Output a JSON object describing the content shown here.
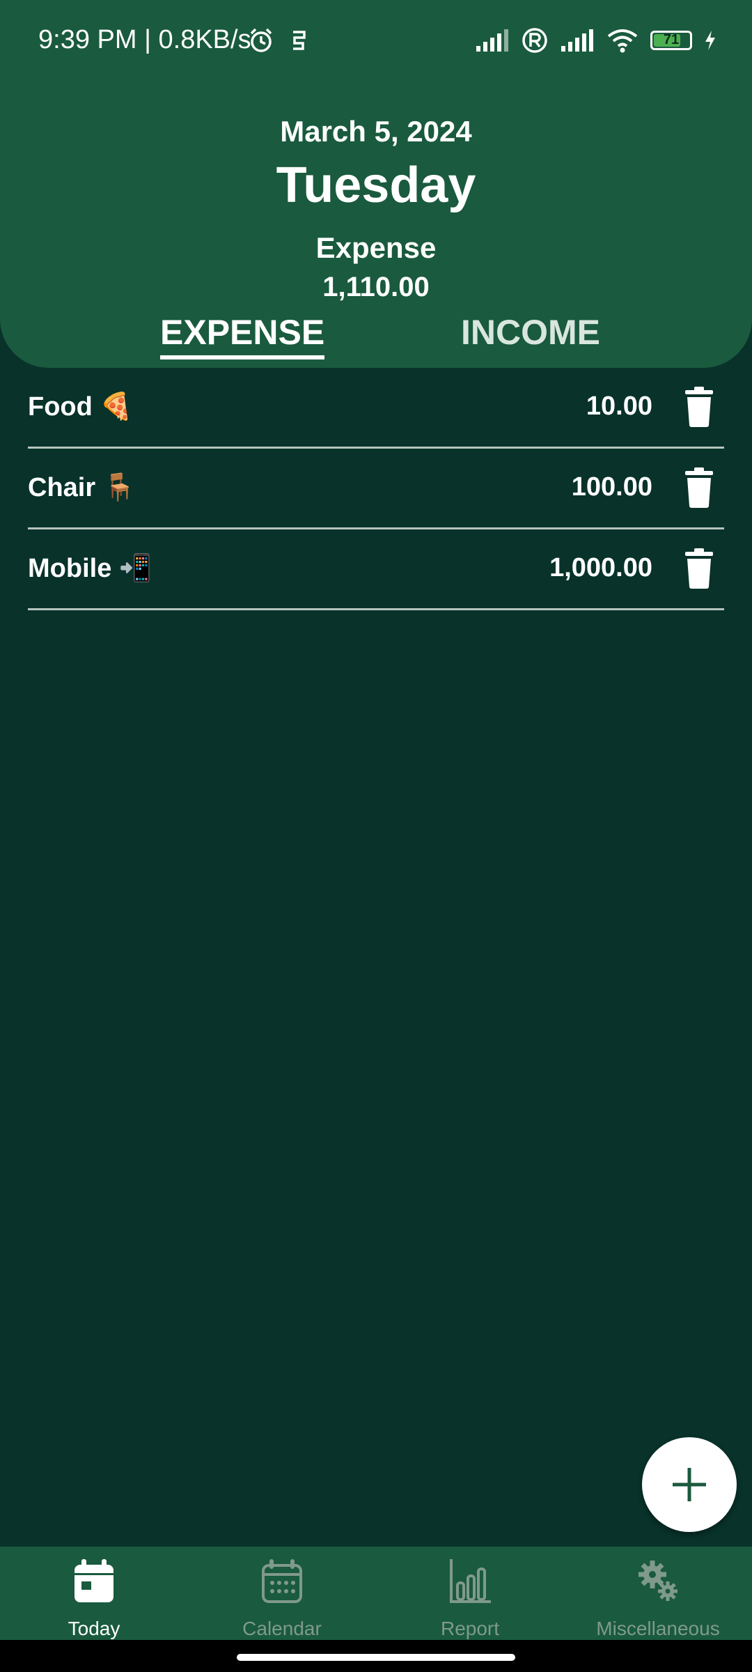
{
  "status_bar": {
    "time_and_speed": "9:39 PM | 0.8KB/s",
    "battery_level": "71",
    "icons": [
      "alarm-icon",
      "notification-icon",
      "signal-icon",
      "registered-icon",
      "signal-icon",
      "wifi-icon",
      "battery-icon",
      "charging-icon"
    ]
  },
  "header": {
    "date": "March 5, 2024",
    "weekday": "Tuesday",
    "summary_label": "Expense",
    "summary_value": "1,110.00"
  },
  "tabs": [
    {
      "label": "EXPENSE",
      "active": true
    },
    {
      "label": "INCOME",
      "active": false
    }
  ],
  "entries": [
    {
      "name": "Food 🍕",
      "amount": "10.00",
      "icon": "trash-icon"
    },
    {
      "name": "Chair 🪑",
      "amount": "100.00",
      "icon": "trash-icon"
    },
    {
      "name": "Mobile 📲",
      "amount": "1,000.00",
      "icon": "trash-icon"
    }
  ],
  "fab": {
    "icon": "plus-icon"
  },
  "nav": [
    {
      "label": "Today",
      "icon": "calendar-day-icon",
      "active": true
    },
    {
      "label": "Calendar",
      "icon": "calendar-icon",
      "active": false
    },
    {
      "label": "Report",
      "icon": "bar-chart-icon",
      "active": false
    },
    {
      "label": "Miscellaneous",
      "icon": "gears-icon",
      "active": false
    }
  ],
  "colors": {
    "header_bg": "#1a5a3e",
    "body_bg": "#08322a",
    "nav_inactive": "#7f9a8b",
    "battery_fill": "#4caf50"
  }
}
